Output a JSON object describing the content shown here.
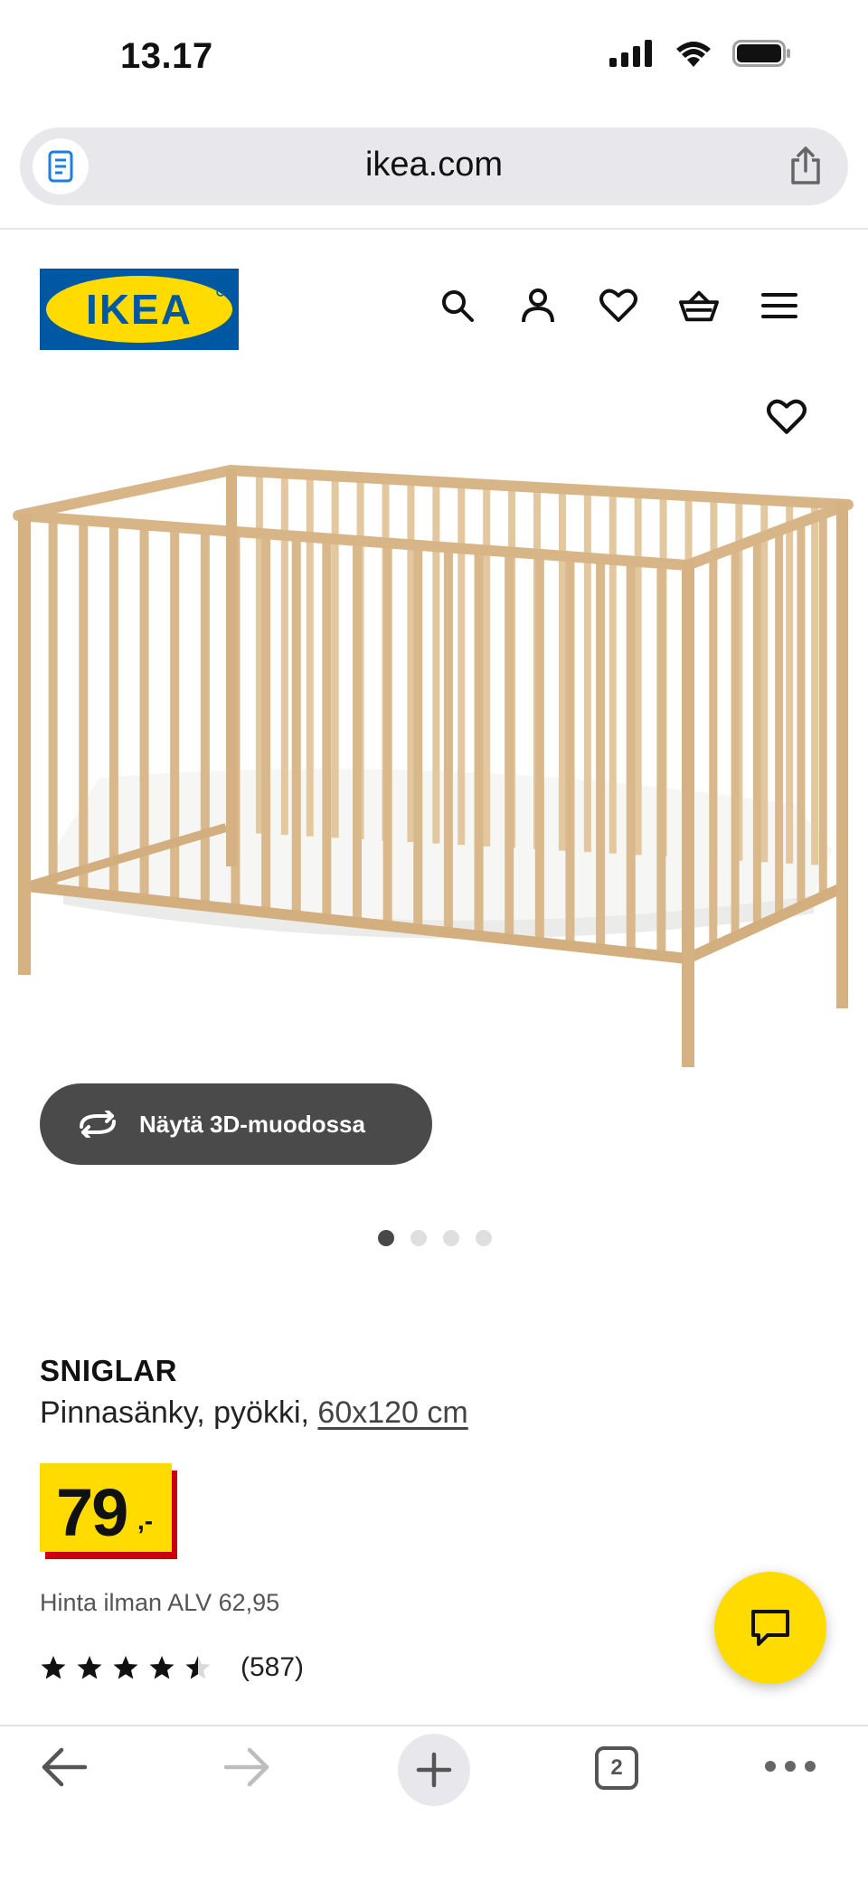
{
  "status_bar": {
    "time": "13.17"
  },
  "browser": {
    "url": "ikea.com",
    "open_tabs": "2"
  },
  "brand": {
    "logo_text": "IKEA",
    "blue": "#0058a3",
    "yellow": "#ffdb00"
  },
  "header": {
    "icons": [
      "search-icon",
      "account-icon",
      "favorites-heart-icon",
      "shopping-basket-icon",
      "menu-icon"
    ]
  },
  "product": {
    "view_3d_label": "Näytä 3D-muodossa",
    "carousel": {
      "count": 4,
      "active": 1
    },
    "name": "SNIGLAR",
    "description": "Pinnasänky, pyökki,",
    "size": "60x120 cm",
    "price": "79",
    "price_suffix": ",-",
    "price_excl_vat": "Hinta ilman ALV 62,95",
    "rating": 4.5,
    "rating_max": 5,
    "review_count": "(587)"
  }
}
